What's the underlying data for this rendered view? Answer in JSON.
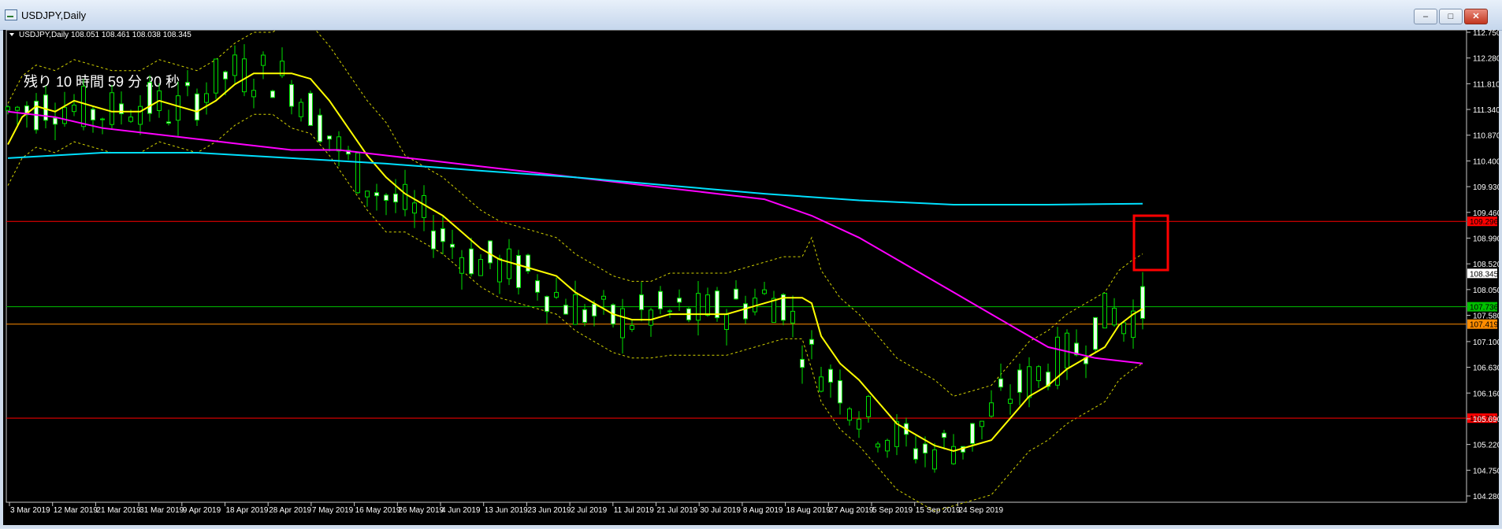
{
  "window": {
    "title": "USDJPY,Daily",
    "buttons": [
      "–",
      "□",
      "✕"
    ]
  },
  "chart_data": {
    "type": "candlestick",
    "symbol_info": "USDJPY,Daily  108.051 108.461 108.038 108.345",
    "overlay_text": "残り 10 時間 59 分 20 秒",
    "ylim": [
      104.28,
      112.75
    ],
    "y_ticks": [
      "112.750",
      "112.280",
      "111.810",
      "111.340",
      "110.870",
      "110.400",
      "109.930",
      "109.460",
      "108.990",
      "108.520",
      "108.050",
      "107.580",
      "107.100",
      "106.630",
      "106.160",
      "105.690",
      "105.220",
      "104.750",
      "104.280"
    ],
    "x_ticks": [
      "3 Mar 2019",
      "12 Mar 2019",
      "21 Mar 2019",
      "31 Mar 2019",
      "9 Apr 2019",
      "18 Apr 2019",
      "28 Apr 2019",
      "7 May 2019",
      "16 May 2019",
      "26 May 2019",
      "4 Jun 2019",
      "13 Jun 2019",
      "23 Jun 2019",
      "2 Jul 2019",
      "11 Jul 2019",
      "21 Jul 2019",
      "30 Jul 2019",
      "8 Aug 2019",
      "18 Aug 2019",
      "27 Aug 2019",
      "5 Sep 2019",
      "15 Sep 2019",
      "24 Sep 2019"
    ],
    "horizontal_lines": [
      {
        "label": "109.296",
        "value": 109.296,
        "color": "#ff0000"
      },
      {
        "label": "107.736",
        "value": 107.736,
        "color": "#00c000"
      },
      {
        "label": "107.419",
        "value": 107.419,
        "color": "#ff8c00"
      },
      {
        "label": "105.701",
        "value": 105.701,
        "color": "#ff0000"
      }
    ],
    "current_price": {
      "label": "108.345",
      "value": 108.345
    },
    "series": [
      {
        "name": "MA",
        "color": "#ffff00",
        "points": [
          [
            0,
            110.7
          ],
          [
            15,
            111.2
          ],
          [
            30,
            111.4
          ],
          [
            50,
            111.3
          ],
          [
            70,
            111.5
          ],
          [
            90,
            111.4
          ],
          [
            110,
            111.3
          ],
          [
            125,
            111.3
          ],
          [
            140,
            111.3
          ],
          [
            160,
            111.5
          ],
          [
            180,
            111.4
          ],
          [
            200,
            111.3
          ],
          [
            220,
            111.5
          ],
          [
            240,
            111.8
          ],
          [
            260,
            112.0
          ],
          [
            280,
            112.0
          ],
          [
            300,
            112.0
          ],
          [
            320,
            111.9
          ],
          [
            340,
            111.5
          ],
          [
            360,
            111.0
          ],
          [
            380,
            110.5
          ],
          [
            400,
            110.1
          ],
          [
            420,
            109.8
          ],
          [
            440,
            109.6
          ],
          [
            460,
            109.4
          ],
          [
            480,
            109.1
          ],
          [
            500,
            108.8
          ],
          [
            520,
            108.6
          ],
          [
            540,
            108.5
          ],
          [
            560,
            108.4
          ],
          [
            580,
            108.3
          ],
          [
            600,
            108.0
          ],
          [
            620,
            107.8
          ],
          [
            640,
            107.6
          ],
          [
            660,
            107.5
          ],
          [
            680,
            107.5
          ],
          [
            700,
            107.6
          ],
          [
            720,
            107.6
          ],
          [
            740,
            107.6
          ],
          [
            760,
            107.6
          ],
          [
            780,
            107.7
          ],
          [
            800,
            107.8
          ],
          [
            820,
            107.9
          ],
          [
            840,
            107.9
          ],
          [
            850,
            107.8
          ],
          [
            860,
            107.2
          ],
          [
            880,
            106.7
          ],
          [
            900,
            106.4
          ],
          [
            920,
            106.0
          ],
          [
            940,
            105.6
          ],
          [
            960,
            105.4
          ],
          [
            980,
            105.2
          ],
          [
            1000,
            105.1
          ],
          [
            1020,
            105.2
          ],
          [
            1040,
            105.3
          ],
          [
            1060,
            105.7
          ],
          [
            1080,
            106.1
          ],
          [
            1100,
            106.3
          ],
          [
            1120,
            106.6
          ],
          [
            1140,
            106.8
          ],
          [
            1160,
            107.0
          ],
          [
            1175,
            107.4
          ],
          [
            1190,
            107.6
          ],
          [
            1200,
            107.7
          ]
        ]
      },
      {
        "name": "SMA_slow",
        "color": "#ff00ff",
        "points": [
          [
            0,
            111.3
          ],
          [
            50,
            111.2
          ],
          [
            100,
            111.0
          ],
          [
            150,
            110.9
          ],
          [
            200,
            110.8
          ],
          [
            250,
            110.7
          ],
          [
            300,
            110.6
          ],
          [
            350,
            110.6
          ],
          [
            400,
            110.5
          ],
          [
            450,
            110.4
          ],
          [
            500,
            110.3
          ],
          [
            550,
            110.2
          ],
          [
            600,
            110.1
          ],
          [
            650,
            110.0
          ],
          [
            700,
            109.9
          ],
          [
            750,
            109.8
          ],
          [
            800,
            109.7
          ],
          [
            850,
            109.4
          ],
          [
            900,
            109.0
          ],
          [
            950,
            108.5
          ],
          [
            1000,
            108.0
          ],
          [
            1050,
            107.5
          ],
          [
            1100,
            107.0
          ],
          [
            1150,
            106.8
          ],
          [
            1200,
            106.7
          ]
        ]
      },
      {
        "name": "SMA_long",
        "color": "#00e0ff",
        "points": [
          [
            0,
            110.45
          ],
          [
            100,
            110.55
          ],
          [
            200,
            110.55
          ],
          [
            300,
            110.45
          ],
          [
            400,
            110.35
          ],
          [
            500,
            110.22
          ],
          [
            600,
            110.1
          ],
          [
            700,
            109.95
          ],
          [
            800,
            109.8
          ],
          [
            900,
            109.68
          ],
          [
            1000,
            109.6
          ],
          [
            1100,
            109.6
          ],
          [
            1200,
            109.62
          ]
        ]
      }
    ]
  }
}
